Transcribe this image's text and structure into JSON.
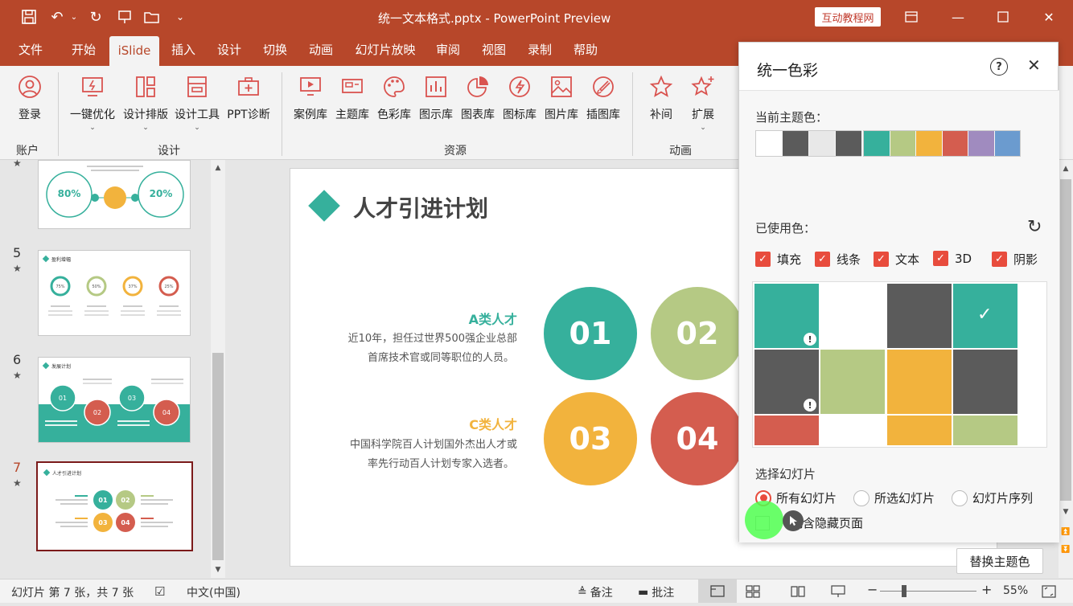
{
  "window": {
    "title": "统一文本格式.pptx - PowerPoint Preview",
    "brand_badge": "互动教程网"
  },
  "menu": [
    "文件",
    "开始",
    "iSlide",
    "插入",
    "设计",
    "切换",
    "动画",
    "幻灯片放映",
    "审阅",
    "视图",
    "录制",
    "帮助"
  ],
  "ribbon": {
    "account": {
      "login": "登录",
      "group": "账户"
    },
    "design": {
      "items": [
        "一键优化",
        "设计排版",
        "设计工具",
        "PPT诊断"
      ],
      "group": "设计"
    },
    "resources": {
      "items": [
        "案例库",
        "主题库",
        "色彩库",
        "图示库",
        "图表库",
        "图标库",
        "图片库",
        "插图库"
      ],
      "group": "资源"
    },
    "animation": {
      "items": [
        "补间",
        "扩展"
      ],
      "group": "动画"
    }
  },
  "thumbnails": {
    "slide4": {
      "pct_left": "80%",
      "pct_right": "20%"
    },
    "slide5": {
      "num": "5",
      "title": "盈利增幅",
      "pcts": [
        "75%",
        "50%",
        "37%",
        "25%"
      ]
    },
    "slide6": {
      "num": "6",
      "title": "发展计划",
      "nums": [
        "01",
        "02",
        "03",
        "04"
      ]
    },
    "slide7": {
      "num": "7",
      "title": "人才引进计划",
      "nums": [
        "01",
        "02",
        "03",
        "04"
      ]
    }
  },
  "slide": {
    "title": "人才引进计划",
    "a_label": "A类人才",
    "a_desc1": "近10年，担任过世界500强企业总部",
    "a_desc2": "首席技术官或同等职位的人员。",
    "c_label": "C类人才",
    "c_desc1": "中国科学院百人计划国外杰出人才或",
    "c_desc2": "率先行动百人计划专家入选者。",
    "circles": [
      "01",
      "02",
      "03",
      "04"
    ]
  },
  "panel": {
    "title": "统一色彩",
    "current_theme_label": "当前主题色：",
    "theme_colors": [
      "#ffffff",
      "#5b5b5b",
      "#e8e8e8",
      "#5b5b5b",
      "#36b09c",
      "#b5c984",
      "#f2b33d",
      "#d45d4f",
      "#a08bbf",
      "#6b9bcf"
    ],
    "used_label": "已使用色：",
    "checks": [
      "填充",
      "线条",
      "文本",
      "3D",
      "阴影"
    ],
    "select_label": "选择幻灯片",
    "radios": [
      "所有幻灯片",
      "所选幻灯片",
      "幻灯片序列"
    ],
    "include_hidden": "包含隐藏页面",
    "replace_button": "替换主题色"
  },
  "status": {
    "slide_info": "幻灯片 第 7 张，共 7 张",
    "language": "中文(中国)",
    "notes": "备注",
    "comments": "批注",
    "zoom": "55%"
  }
}
